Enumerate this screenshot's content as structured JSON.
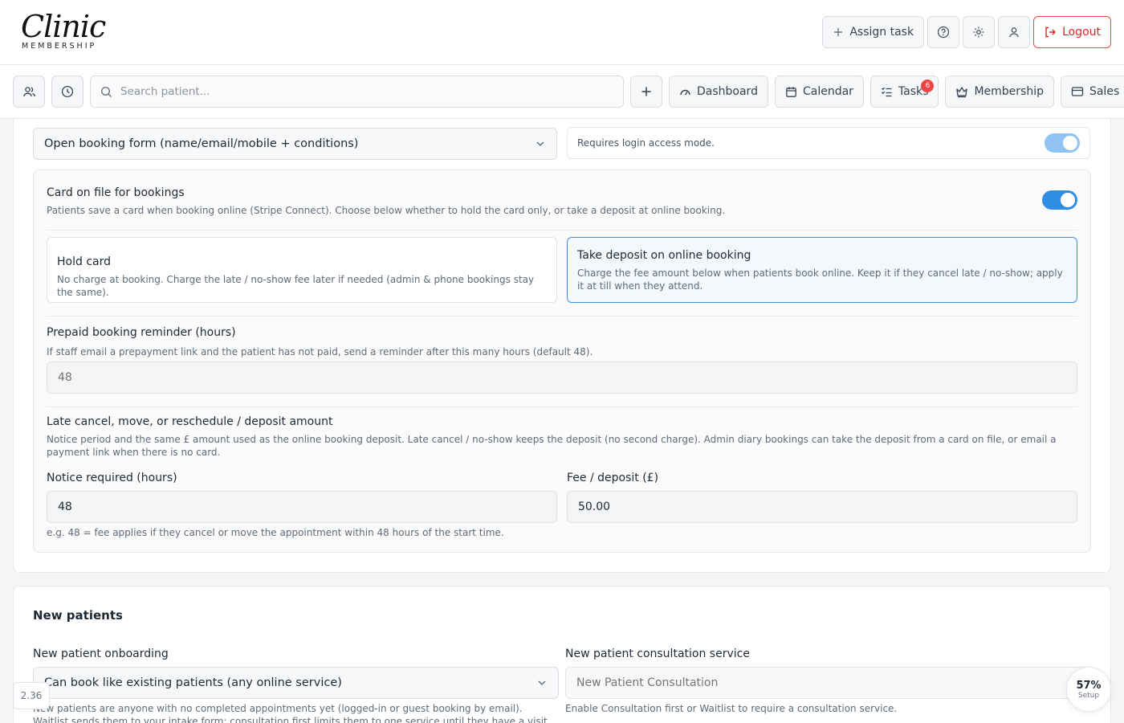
{
  "header": {
    "logo_script": "Clinic",
    "logo_sub": "MEMBERSHIP",
    "assign_task_label": "Assign task",
    "logout_label": "Logout"
  },
  "nav": {
    "search_placeholder": "Search patient...",
    "dashboard_label": "Dashboard",
    "calendar_label": "Calendar",
    "tasks_label": "Tasks",
    "tasks_badge": "6",
    "membership_label": "Membership",
    "sales_label": "Sales"
  },
  "booking": {
    "booking_form_value": "Open booking form (name/email/mobile + conditions)",
    "login_access_text": "Requires login access mode.",
    "login_access_enabled": true,
    "card_on_file": {
      "title": "Card on file for bookings",
      "description": "Patients save a card when booking online (Stripe Connect). Choose below whether to hold the card only, or take a deposit at online booking.",
      "enabled": true
    },
    "options": [
      {
        "title": "Hold card",
        "description": "No charge at booking. Charge the late / no-show fee later if needed (admin & phone bookings stay the same).",
        "selected": false
      },
      {
        "title": "Take deposit on online booking",
        "description": "Charge the fee amount below when patients book online. Keep it if they cancel late / no-show; apply it at till when they attend.",
        "selected": true
      }
    ],
    "prepaid_reminder": {
      "title": "Prepaid booking reminder (hours)",
      "description": "If staff email a prepayment link and the patient has not paid, send a reminder after this many hours (default 48).",
      "placeholder": "48"
    },
    "late_cancel": {
      "title": "Late cancel, move, or reschedule / deposit amount",
      "description": "Notice period and the same £ amount used as the online booking deposit. Late cancel / no-show keeps the deposit (no second charge). Admin diary bookings can take the deposit from a card on file, or email a payment link when there is no card.",
      "notice_label": "Notice required (hours)",
      "notice_value": "48",
      "fee_label": "Fee / deposit (£)",
      "fee_value": "50.00",
      "example": "e.g. 48 = fee applies if they cancel or move the appointment within 48 hours of the start time."
    }
  },
  "new_patients": {
    "section_title": "New patients",
    "onboarding_label": "New patient onboarding",
    "onboarding_value": "Can book like existing patients (any online service)",
    "onboarding_hint": "New patients are anyone with no completed appointments yet (logged-in or guest booking by email). Waitlist sends them to your intake form; consultation first limits them to one service until they have a visit.",
    "consultation_label": "New patient consultation service",
    "consultation_placeholder": "New Patient Consultation",
    "consultation_hint": "Enable Consultation first or Waitlist to require a consultation service."
  },
  "footer": {
    "version": "2.36",
    "setup_percent": "57%",
    "setup_label": "Setup"
  },
  "colors": {
    "accent": "#2f8de4",
    "logout": "#dc2626",
    "badge": "#ef4444"
  }
}
